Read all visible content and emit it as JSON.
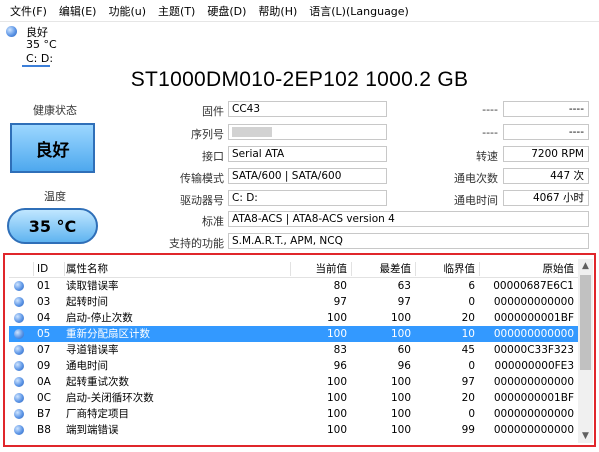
{
  "menu": [
    "文件(F)",
    "编辑(E)",
    "功能(u)",
    "主题(T)",
    "硬盘(D)",
    "帮助(H)",
    "语言(L)(Language)"
  ],
  "drive": {
    "status": "良好",
    "temp": "35 °C",
    "letter": "C: D:"
  },
  "model": "ST1000DM010-2EP102 1000.2 GB",
  "health": {
    "label": "健康状态",
    "value": "良好"
  },
  "temperature": {
    "label": "温度",
    "value": "35 °C"
  },
  "info": {
    "firmware": {
      "label": "固件",
      "value": "CC43"
    },
    "serial": {
      "label": "序列号",
      "value": ""
    },
    "interface": {
      "label": "接口",
      "value": "Serial ATA"
    },
    "transfer": {
      "label": "传输模式",
      "value": "SATA/600 | SATA/600"
    },
    "driveletter": {
      "label": "驱动器号",
      "value": "C: D:"
    },
    "standard": {
      "label": "标准",
      "value": "ATA8-ACS | ATA8-ACS version 4"
    },
    "features": {
      "label": "支持的功能",
      "value": "S.M.A.R.T., APM, NCQ"
    }
  },
  "right": {
    "blank1": {
      "label": "----",
      "value": "----"
    },
    "blank2": {
      "label": "----",
      "value": "----"
    },
    "rpm": {
      "label": "转速",
      "value": "7200 RPM"
    },
    "powercount": {
      "label": "通电次数",
      "value": "447 次"
    },
    "powerhours": {
      "label": "通电时间",
      "value": "4067 小时"
    }
  },
  "smart": {
    "headers": {
      "id": "ID",
      "name": "属性名称",
      "current": "当前值",
      "worst": "最差值",
      "threshold": "临界值",
      "raw": "原始值"
    },
    "rows": [
      {
        "id": "01",
        "name": "读取错误率",
        "current": "80",
        "worst": "63",
        "threshold": "6",
        "raw": "00000687E6C1"
      },
      {
        "id": "03",
        "name": "起转时间",
        "current": "97",
        "worst": "97",
        "threshold": "0",
        "raw": "000000000000"
      },
      {
        "id": "04",
        "name": "启动-停止次数",
        "current": "100",
        "worst": "100",
        "threshold": "20",
        "raw": "0000000001BF"
      },
      {
        "id": "05",
        "name": "重新分配扇区计数",
        "current": "100",
        "worst": "100",
        "threshold": "10",
        "raw": "000000000000"
      },
      {
        "id": "07",
        "name": "寻道错误率",
        "current": "83",
        "worst": "60",
        "threshold": "45",
        "raw": "00000C33F323"
      },
      {
        "id": "09",
        "name": "通电时间",
        "current": "96",
        "worst": "96",
        "threshold": "0",
        "raw": "000000000FE3"
      },
      {
        "id": "0A",
        "name": "起转重试次数",
        "current": "100",
        "worst": "100",
        "threshold": "97",
        "raw": "000000000000"
      },
      {
        "id": "0C",
        "name": "启动-关闭循环次数",
        "current": "100",
        "worst": "100",
        "threshold": "20",
        "raw": "0000000001BF"
      },
      {
        "id": "B7",
        "name": "厂商特定项目",
        "current": "100",
        "worst": "100",
        "threshold": "0",
        "raw": "000000000000"
      },
      {
        "id": "B8",
        "name": "端到端错误",
        "current": "100",
        "worst": "100",
        "threshold": "99",
        "raw": "000000000000"
      }
    ]
  }
}
